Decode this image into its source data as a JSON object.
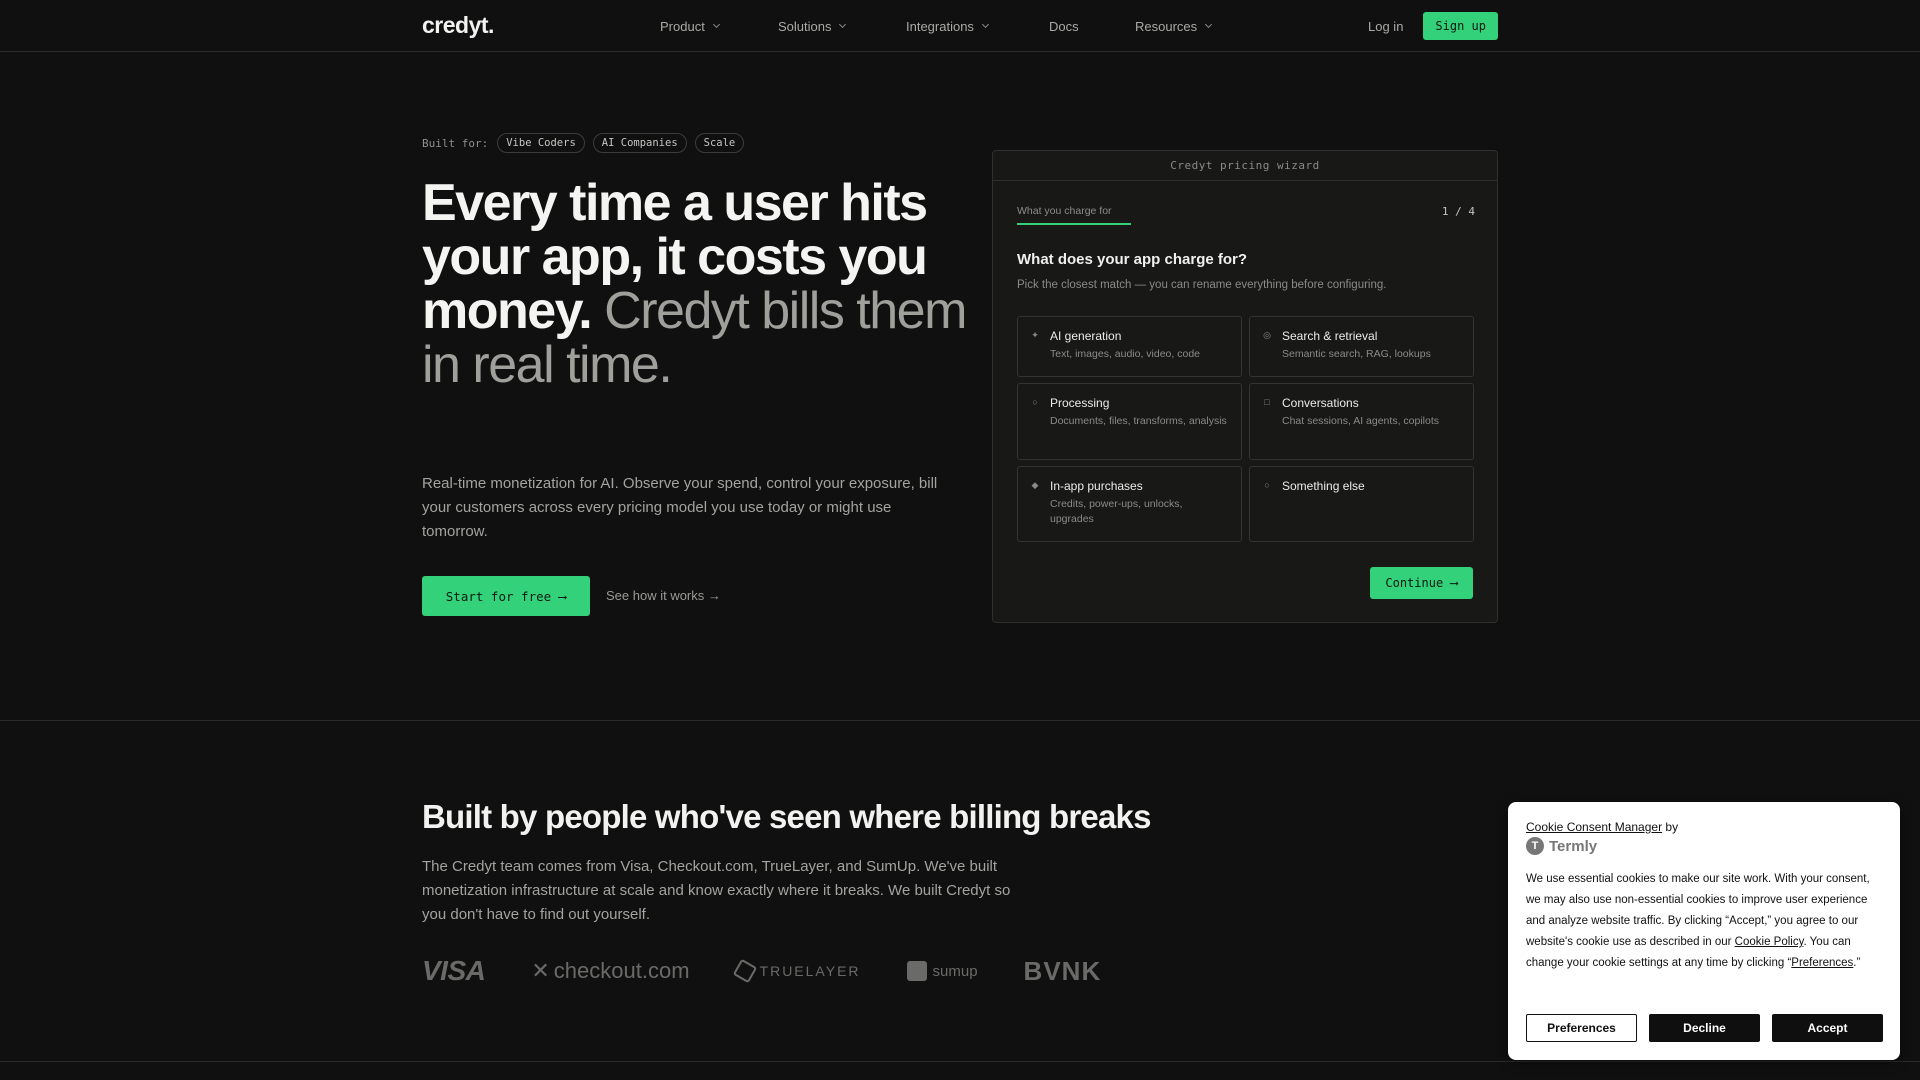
{
  "nav": {
    "logo": "credyt.",
    "links": [
      {
        "label": "Product",
        "has_dropdown": true
      },
      {
        "label": "Solutions",
        "has_dropdown": true
      },
      {
        "label": "Integrations",
        "has_dropdown": true
      },
      {
        "label": "Docs",
        "has_dropdown": false
      },
      {
        "label": "Resources",
        "has_dropdown": true
      }
    ],
    "login": "Log in",
    "signup": "Sign up"
  },
  "hero": {
    "built_for_label": "Built for:",
    "chips": [
      "Vibe Coders",
      "AI Companies",
      "Scale"
    ],
    "headline_bold": "Every time a user hits your app, it costs you money.",
    "headline_muted": "Credyt bills them in real time.",
    "subtext": "Real-time monetization for AI. Observe your spend, control your exposure, bill your customers across every pricing model you use today or might use tomorrow.",
    "cta_primary": "Start for free ⟶",
    "cta_secondary": "See how it works →"
  },
  "wizard": {
    "title": "Credyt pricing wizard",
    "tab": "What you charge for",
    "step": "1 / 4",
    "question": "What does your app charge for?",
    "subtitle": "Pick the closest match — you can rename everything before configuring.",
    "options": [
      {
        "icon": "sparkle-icon",
        "title": "AI generation",
        "desc": "Text, images, audio, video, code"
      },
      {
        "icon": "target-icon",
        "title": "Search & retrieval",
        "desc": "Semantic search, RAG, lookups"
      },
      {
        "icon": "circle-icon",
        "title": "Processing",
        "desc": "Documents, files, transforms, analysis"
      },
      {
        "icon": "square-icon",
        "title": "Conversations",
        "desc": "Chat sessions, AI agents, copilots"
      },
      {
        "icon": "diamond-icon",
        "title": "In-app purchases",
        "desc": "Credits, power-ups, unlocks, upgrades"
      },
      {
        "icon": "circle-icon",
        "title": "Something else",
        "desc": ""
      }
    ],
    "continue": "Continue ⟶"
  },
  "team": {
    "title": "Built by people who've seen where billing breaks",
    "text": "The Credyt team comes from Visa, Checkout.com, TrueLayer, and SumUp. We've built monetization infrastructure at scale and know exactly where it breaks. We built Credyt so you don't have to find out yourself.",
    "logos": {
      "visa": "VISA",
      "checkout": "checkout.com",
      "truelayer": "TRUELAYER",
      "sumup": "sumup",
      "bvnk": "BVNK"
    }
  },
  "cookie": {
    "heading": "Cookie Consent Manager",
    "by": " by",
    "brand": "Termly",
    "text_1": "We use essential cookies to make our site work. With your consent, we may also use non-essential cookies to improve user experience and analyze website traffic. By clicking “Accept,” you agree to our website's cookie use as described in our ",
    "link_policy": "Cookie Policy",
    "text_2": ". You can change your cookie settings at any time by clicking “",
    "link_prefs": "Preferences",
    "text_3": ".”",
    "btn_preferences": "Preferences",
    "btn_decline": "Decline",
    "btn_accept": "Accept"
  },
  "colors": {
    "accent": "#33d17a",
    "background": "#101010",
    "card": "#181817"
  }
}
